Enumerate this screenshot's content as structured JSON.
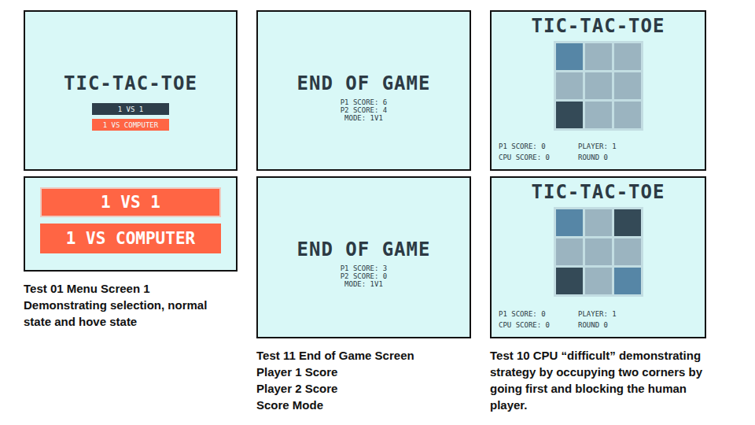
{
  "columns": [
    {
      "screens": [
        {
          "kind": "menu",
          "title": "TIC-TAC-TOE",
          "buttons": [
            {
              "label": "1 VS 1",
              "hovered": false,
              "selected": false
            },
            {
              "label": "1 VS COMPUTER",
              "hovered": true,
              "selected": false
            }
          ]
        },
        {
          "kind": "buttons",
          "buttons": [
            {
              "label": "1 VS 1",
              "hovered": true,
              "selected": true
            },
            {
              "label": "1 VS COMPUTER",
              "hovered": true,
              "selected": false
            }
          ]
        }
      ],
      "caption": [
        "Test 01 Menu Screen 1",
        "Demonstrating selection, normal",
        "state and hove state"
      ]
    },
    {
      "screens": [
        {
          "kind": "end",
          "title": "END OF GAME",
          "lines": [
            "P1 SCORE: 6",
            "P2 SCORE: 4",
            "MODE: 1V1"
          ]
        },
        {
          "kind": "end",
          "title": "END OF GAME",
          "lines": [
            "P1 SCORE: 3",
            "P2 SCORE: 0",
            "MODE: 1V1"
          ]
        }
      ],
      "caption": [
        "Test 11 End of Game Screen",
        "Player 1 Score",
        "Player 2 Score",
        "Score Mode"
      ]
    },
    {
      "screens": [
        {
          "kind": "game",
          "title": "TIC-TAC-TOE",
          "board": [
            "p1",
            "empty",
            "empty",
            "empty",
            "empty",
            "empty",
            "cpu",
            "empty",
            "empty"
          ],
          "stats": [
            "P1 SCORE: 0",
            "PLAYER: 1",
            "CPU SCORE: 0",
            "ROUND 0"
          ]
        },
        {
          "kind": "game",
          "title": "TIC-TAC-TOE",
          "board": [
            "p1",
            "empty",
            "cpu",
            "empty",
            "empty",
            "empty",
            "cpu",
            "empty",
            "p1"
          ],
          "stats": [
            "P1 SCORE: 0",
            "PLAYER: 1",
            "CPU SCORE: 0",
            "ROUND 0"
          ]
        }
      ],
      "caption": [
        "Test 10 CPU “difficult” demonstrating",
        "strategy by occupying two corners by",
        "going first and blocking the human",
        "player."
      ]
    }
  ]
}
